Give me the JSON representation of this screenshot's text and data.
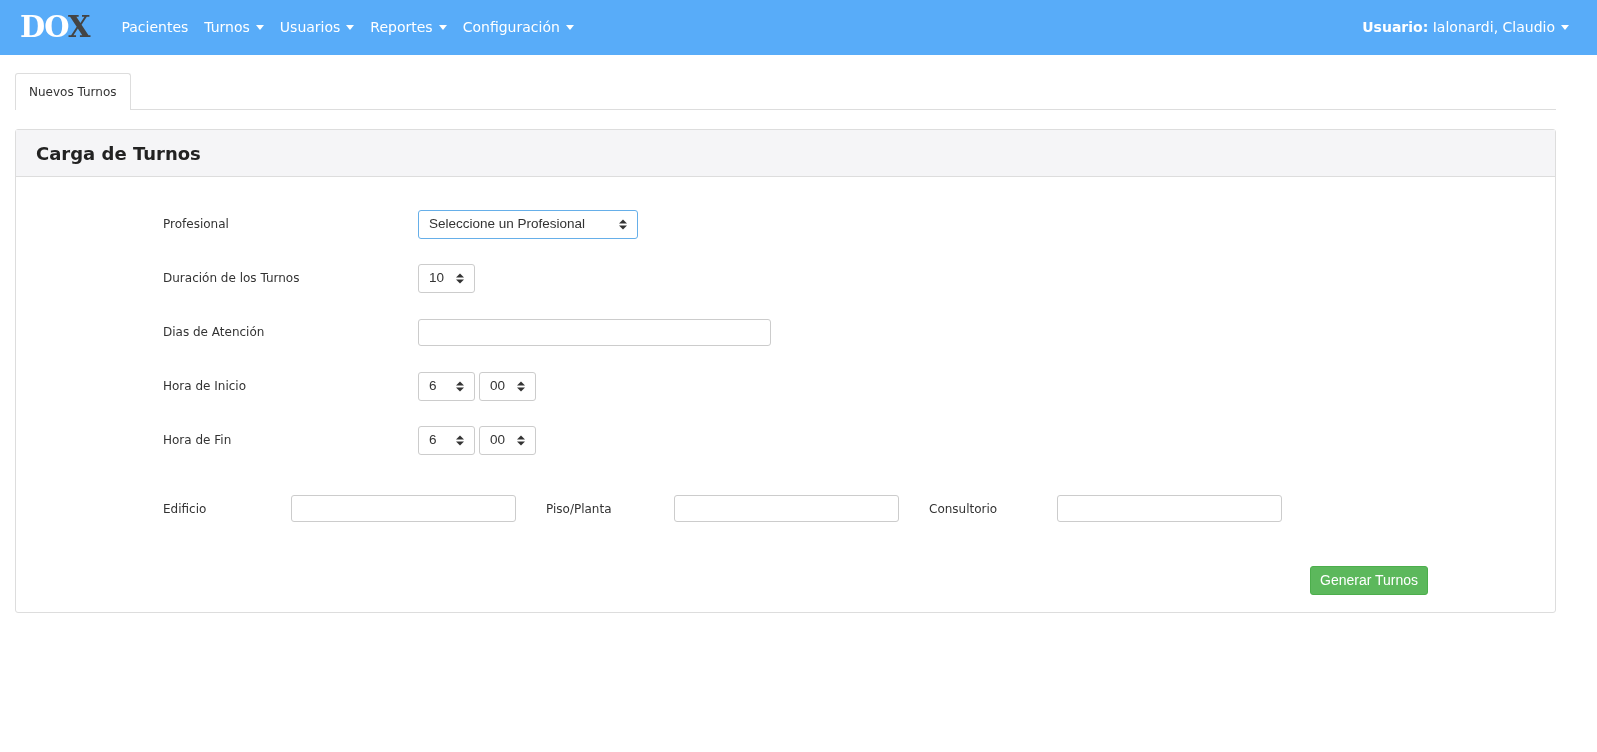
{
  "navbar": {
    "logo": "DOX",
    "items": [
      {
        "label": "Pacientes",
        "dropdown": false
      },
      {
        "label": "Turnos",
        "dropdown": true
      },
      {
        "label": "Usuarios",
        "dropdown": true
      },
      {
        "label": "Reportes",
        "dropdown": true
      },
      {
        "label": "Configuración",
        "dropdown": true
      }
    ],
    "user": {
      "label": "Usuario:",
      "value": "Ialonardi, Claudio",
      "dropdown": true
    }
  },
  "tabs": [
    {
      "label": "Nuevos Turnos",
      "selected": true
    }
  ],
  "panel": {
    "title": "Carga de Turnos",
    "fields": [
      {
        "kind": "select",
        "label": "Profesional",
        "focused": true,
        "values": [
          "Seleccione un Profesional"
        ]
      },
      {
        "kind": "select",
        "label": "Duración de los Turnos",
        "focused": false,
        "values": [
          "10"
        ]
      },
      {
        "kind": "input",
        "label": "Dias de Atención",
        "focused": false
      },
      {
        "kind": "select",
        "label": "Hora de Inicio",
        "focused": false,
        "values": [
          "6",
          "00"
        ]
      },
      {
        "kind": "select",
        "label": "Hora de Fin",
        "focused": false,
        "values": [
          "6",
          "00"
        ]
      }
    ],
    "location": [
      {
        "label": "Edificio"
      },
      {
        "label": "Piso/Planta"
      },
      {
        "label": "Consultorio"
      }
    ],
    "submit": "Generar Turnos"
  }
}
